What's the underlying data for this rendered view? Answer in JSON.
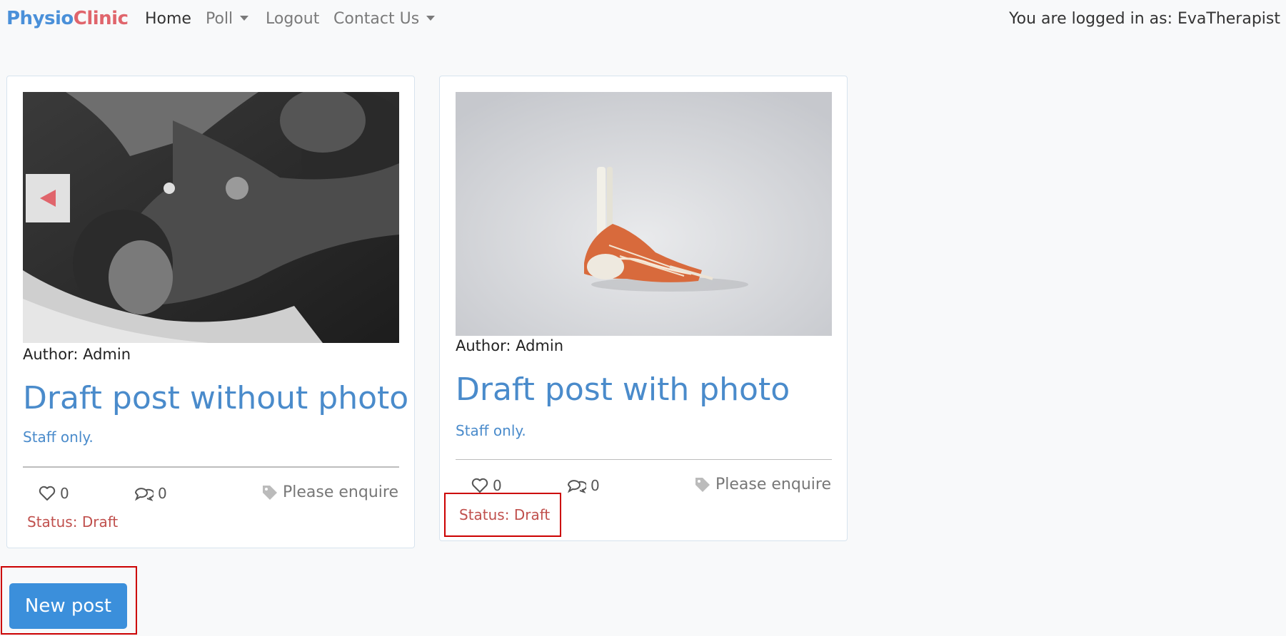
{
  "nav": {
    "brand_part1": "Physio",
    "brand_part2": "Clinic",
    "home": "Home",
    "poll": "Poll",
    "logout": "Logout",
    "contact": "Contact Us",
    "logged_in": "You are logged in as: EvaTherapist"
  },
  "posts": [
    {
      "author": "Author: Admin",
      "title": "Draft post without photo",
      "subtitle": "Staff only.",
      "likes": "0",
      "comments": "0",
      "price": "Please enquire",
      "status": "Status: Draft"
    },
    {
      "author": "Author: Admin",
      "title": "Draft post with photo",
      "subtitle": "Staff only.",
      "likes": "0",
      "comments": "0",
      "price": "Please enquire",
      "status": "Status: Draft"
    }
  ],
  "actions": {
    "new_post": "New post"
  },
  "colors": {
    "brand_blue": "#4a90d9",
    "brand_red": "#e0656c",
    "title_blue": "#4a8bcb",
    "status_red": "#c0504d",
    "button_blue": "#3b8fdb"
  }
}
